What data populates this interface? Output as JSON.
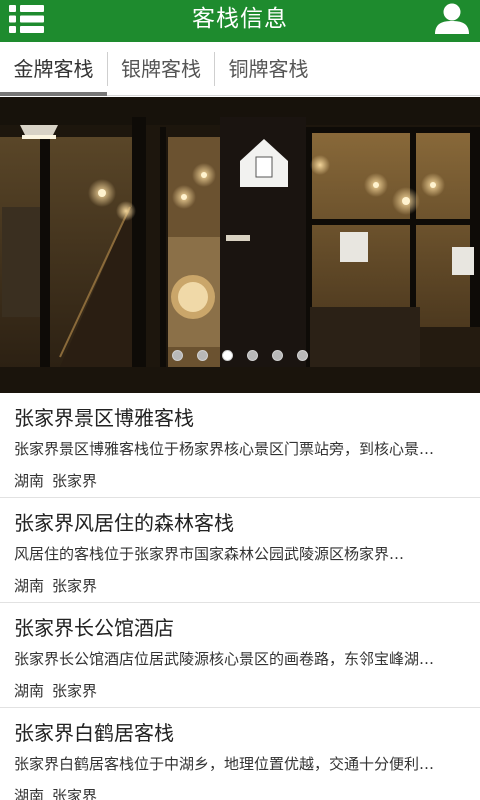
{
  "header": {
    "title": "客栈信息",
    "color": "#1e8b2e",
    "menu_icon": "menu-list-icon",
    "user_icon": "user-icon"
  },
  "tabs": [
    {
      "label": "金牌客栈",
      "active": true
    },
    {
      "label": "银牌客栈",
      "active": false
    },
    {
      "label": "铜牌客栈",
      "active": false
    }
  ],
  "banner": {
    "slides": 6,
    "active_slide": 3
  },
  "inns": [
    {
      "title": "张家界景区博雅客栈",
      "desc": "张家界景区博雅客栈位于杨家界核心景区门票站旁，到核心景…",
      "province": "湖南",
      "city": "张家界"
    },
    {
      "title": "张家界风居住的森林客栈",
      "desc": "风居住的客栈位于张家界市国家森林公园武陵源区杨家界…",
      "province": "湖南",
      "city": "张家界"
    },
    {
      "title": "张家界长公馆酒店",
      "desc": "张家界长公馆酒店位居武陵源核心景区的画卷路，东邻宝峰湖…",
      "province": "湖南",
      "city": "张家界"
    },
    {
      "title": "张家界白鹤居客栈",
      "desc": "张家界白鹤居客栈位于中湖乡，地理位置优越，交通十分便利…",
      "province": "湖南",
      "city": "张家界"
    }
  ]
}
